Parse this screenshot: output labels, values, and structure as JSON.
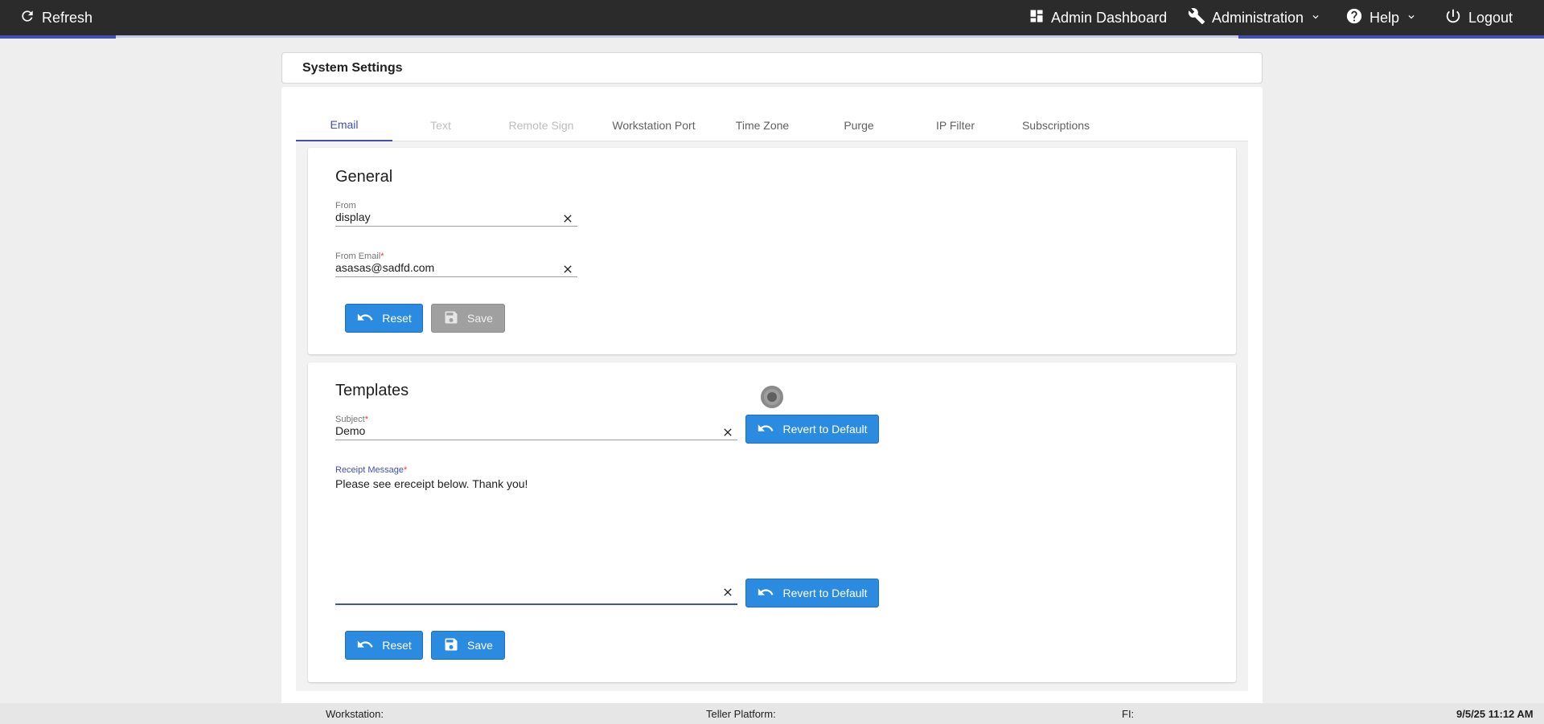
{
  "topbar": {
    "refresh_label": "Refresh",
    "admin_dashboard_label": "Admin Dashboard",
    "administration_label": "Administration",
    "help_label": "Help",
    "logout_label": "Logout"
  },
  "page": {
    "title": "System Settings"
  },
  "tabs": [
    {
      "label": "Email",
      "state": "active"
    },
    {
      "label": "Text",
      "state": "disabled"
    },
    {
      "label": "Remote Sign",
      "state": "disabled"
    },
    {
      "label": "Workstation Port",
      "state": "normal"
    },
    {
      "label": "Time Zone",
      "state": "normal"
    },
    {
      "label": "Purge",
      "state": "normal"
    },
    {
      "label": "IP Filter",
      "state": "normal"
    },
    {
      "label": "Subscriptions",
      "state": "normal"
    }
  ],
  "general": {
    "title": "General",
    "from_label": "From",
    "from_value": "display",
    "from_email_label": "From Email",
    "from_email_value": "asasas@sadfd.com",
    "required_mark": "*",
    "reset_label": "Reset",
    "save_label": "Save"
  },
  "templates": {
    "title": "Templates",
    "subject_label": "Subject",
    "subject_value": "Demo",
    "receipt_label": "Receipt Message",
    "receipt_value": "Please see ereceipt below. Thank you!",
    "required_mark": "*",
    "revert_label": "Revert to Default",
    "reset_label": "Reset",
    "save_label": "Save"
  },
  "footer": {
    "workstation_label": "Workstation:",
    "teller_platform_label": "Teller Platform:",
    "fi_label": "FI:",
    "datetime": "9/5/25 11:12 AM"
  },
  "colors": {
    "topbar_bg": "#2b2b2b",
    "accent": "#3f51b5",
    "button_blue": "#2b8be0",
    "button_disabled": "#a0a0a0",
    "required": "#e53935"
  }
}
